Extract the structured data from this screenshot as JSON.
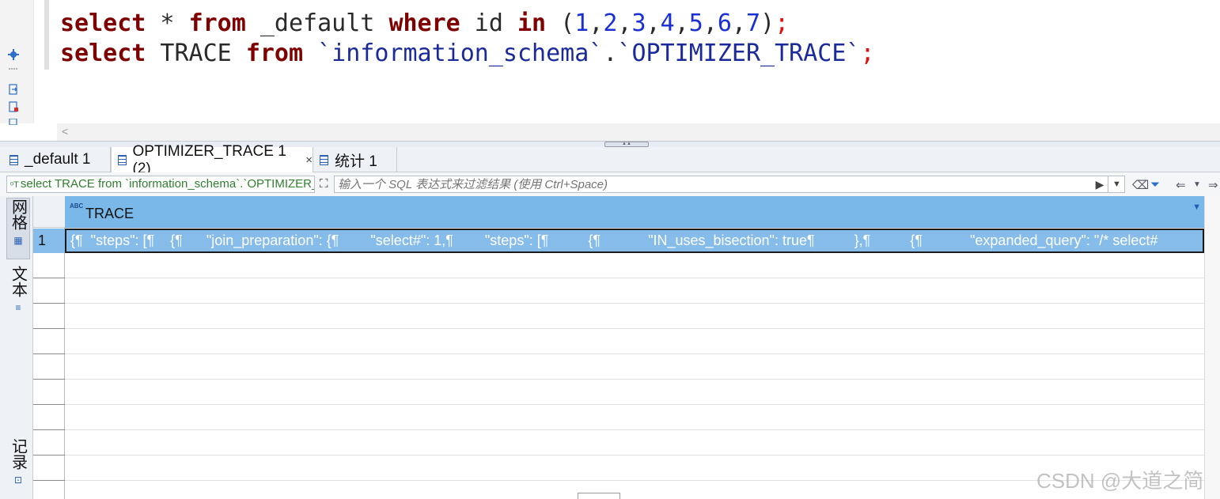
{
  "editor": {
    "line1": [
      {
        "t": "select",
        "c": "kw"
      },
      {
        "t": " * ",
        "c": "id"
      },
      {
        "t": "from",
        "c": "kw"
      },
      {
        "t": " _default ",
        "c": "id"
      },
      {
        "t": "where",
        "c": "kw"
      },
      {
        "t": " id ",
        "c": "id"
      },
      {
        "t": "in",
        "c": "kw"
      },
      {
        "t": " (",
        "c": "id"
      },
      {
        "t": "1",
        "c": "num"
      },
      {
        "t": ",",
        "c": "id"
      },
      {
        "t": "2",
        "c": "num"
      },
      {
        "t": ",",
        "c": "id"
      },
      {
        "t": "3",
        "c": "num"
      },
      {
        "t": ",",
        "c": "id"
      },
      {
        "t": "4",
        "c": "num"
      },
      {
        "t": ",",
        "c": "id"
      },
      {
        "t": "5",
        "c": "num"
      },
      {
        "t": ",",
        "c": "id"
      },
      {
        "t": "6",
        "c": "num"
      },
      {
        "t": ",",
        "c": "id"
      },
      {
        "t": "7",
        "c": "num"
      },
      {
        "t": ")",
        "c": "id"
      },
      {
        "t": ";",
        "c": "punc"
      }
    ],
    "line2": [
      {
        "t": "select",
        "c": "kw"
      },
      {
        "t": " TRACE ",
        "c": "id"
      },
      {
        "t": "from",
        "c": "kw"
      },
      {
        "t": " `information_schema`",
        "c": "str"
      },
      {
        "t": ".",
        "c": "id"
      },
      {
        "t": "`OPTIMIZER_TRACE`",
        "c": "str"
      },
      {
        "t": ";",
        "c": "punc"
      }
    ],
    "scroll_arrow": "<"
  },
  "tabs": [
    {
      "label": "_default 1",
      "active": false
    },
    {
      "label": "OPTIMIZER_TRACE 1 (2)",
      "active": true,
      "close": "×"
    },
    {
      "label": "统计 1",
      "active": false
    }
  ],
  "filterbar": {
    "query_text": "select TRACE from `information_schema`.`OPTIMIZER_TRACE`",
    "query_icon": "ᵒT",
    "filter_placeholder": "输入一个 SQL 表达式来过滤结果 (使用 Ctrl+Space)"
  },
  "sidebar": {
    "grid_label": "网格",
    "text_label": "文本",
    "record_label": "记录"
  },
  "grid": {
    "column_header": "TRACE",
    "column_type_icon": "ABC",
    "rows": [
      {
        "num": "1",
        "trace": "{¶  \"steps\": [¶    {¶      \"join_preparation\": {¶        \"select#\": 1,¶        \"steps\": [¶          {¶            \"IN_uses_bisection\": true¶          },¶          {¶            \"expanded_query\": \"/* select#"
      }
    ]
  },
  "watermark": "CSDN @大道之简"
}
